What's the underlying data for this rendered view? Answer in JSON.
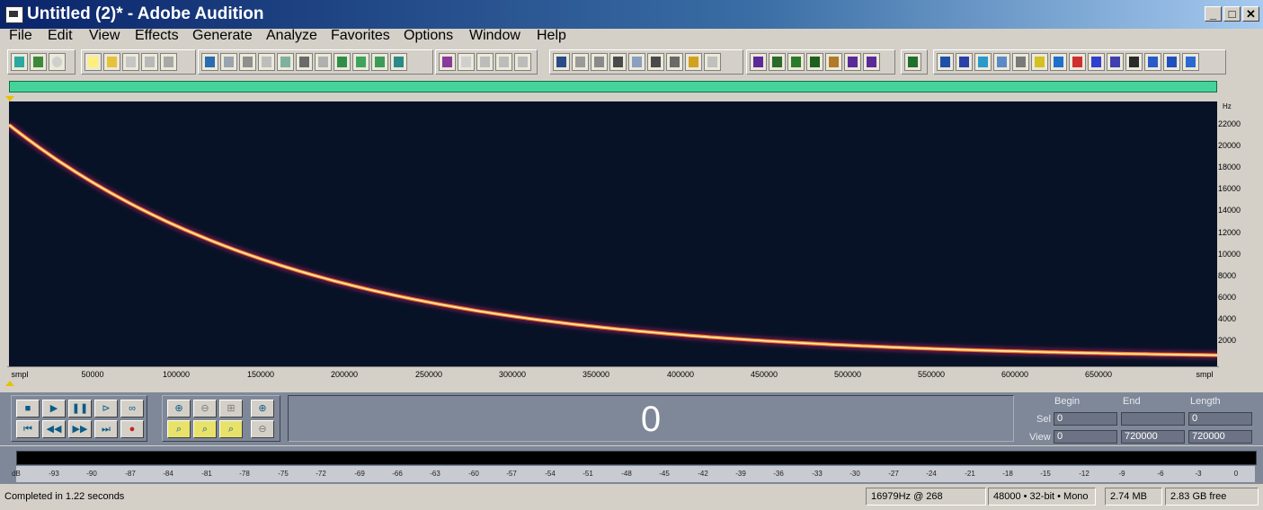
{
  "window": {
    "title": "Untitled (2)* - Adobe Audition"
  },
  "window_controls": {
    "minimize": "_",
    "maximize": "□",
    "close": "✕"
  },
  "menu": [
    "File",
    "Edit",
    "View",
    "Effects",
    "Generate",
    "Analyze",
    "Favorites",
    "Options",
    "Window",
    "Help"
  ],
  "spectral": {
    "y_unit": "Hz",
    "y_ticks": [
      "22000",
      "20000",
      "18000",
      "16000",
      "14000",
      "12000",
      "10000",
      "8000",
      "6000",
      "4000",
      "2000"
    ],
    "x_unit": "smpl",
    "x_ticks": [
      "50000",
      "100000",
      "150000",
      "200000",
      "250000",
      "300000",
      "350000",
      "400000",
      "450000",
      "500000",
      "550000",
      "600000",
      "650000"
    ]
  },
  "transport": {
    "time_display": "0"
  },
  "selection": {
    "headers": {
      "begin": "Begin",
      "end": "End",
      "length": "Length"
    },
    "sel": {
      "label": "Sel",
      "begin": "0",
      "end": "",
      "length": "0"
    },
    "view": {
      "label": "View",
      "begin": "0",
      "end": "720000",
      "length": "720000"
    }
  },
  "meter": {
    "unit": "dB",
    "ticks": [
      "-93",
      "-90",
      "-87",
      "-84",
      "-81",
      "-78",
      "-75",
      "-72",
      "-69",
      "-66",
      "-63",
      "-60",
      "-57",
      "-54",
      "-51",
      "-48",
      "-45",
      "-42",
      "-39",
      "-36",
      "-33",
      "-30",
      "-27",
      "-24",
      "-21",
      "-18",
      "-15",
      "-12",
      "-9",
      "-6",
      "-3",
      "0"
    ]
  },
  "status": {
    "message": "Completed in 1.22 seconds",
    "cursor": "16979Hz @ 268",
    "format": "48000 • 32-bit • Mono",
    "size": "2.74 MB",
    "free": "2.83 GB free"
  },
  "colors": {
    "title_start": "#0a246a",
    "overview": "#46d39a",
    "spectral_bg": "#071226",
    "sweep": "#ffd66a",
    "panel": "#7f8898"
  }
}
